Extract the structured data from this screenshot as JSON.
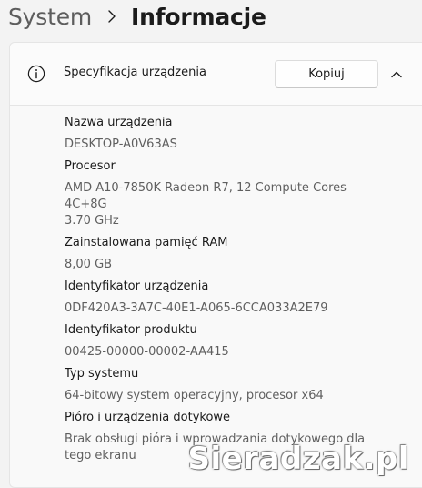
{
  "breadcrumb": {
    "parent": "System",
    "current": "Informacje"
  },
  "section": {
    "title": "Specyfikacja urządzenia",
    "copy_label": "Kopiuj",
    "icon": "info-icon",
    "collapse_icon": "chevron-up-icon",
    "expanded": true
  },
  "specs": [
    {
      "label": "Nazwa urządzenia",
      "value": "DESKTOP-A0V63AS"
    },
    {
      "label": "Procesor",
      "value": "AMD A10-7850K Radeon R7, 12 Compute Cores 4C+8G\n3.70 GHz"
    },
    {
      "label": "Zainstalowana pamięć RAM",
      "value": "8,00 GB"
    },
    {
      "label": "Identyfikator urządzenia",
      "value": "0DF420A3-3A7C-40E1-A065-6CCA033A2E79"
    },
    {
      "label": "Identyfikator produktu",
      "value": "00425-00000-00002-AA415"
    },
    {
      "label": "Typ systemu",
      "value": "64-bitowy system operacyjny, procesor x64"
    },
    {
      "label": "Pióro i urządzenia dotykowe",
      "value": "Brak obsługi pióra i wprowadzania dotykowego dla\ntego ekranu"
    }
  ],
  "watermark": "Sieradzak.pl",
  "colors": {
    "background": "#f3f3f3",
    "card": "#f9f9f9",
    "text_primary": "#1b1b1b",
    "text_secondary": "#5f5f5f"
  }
}
